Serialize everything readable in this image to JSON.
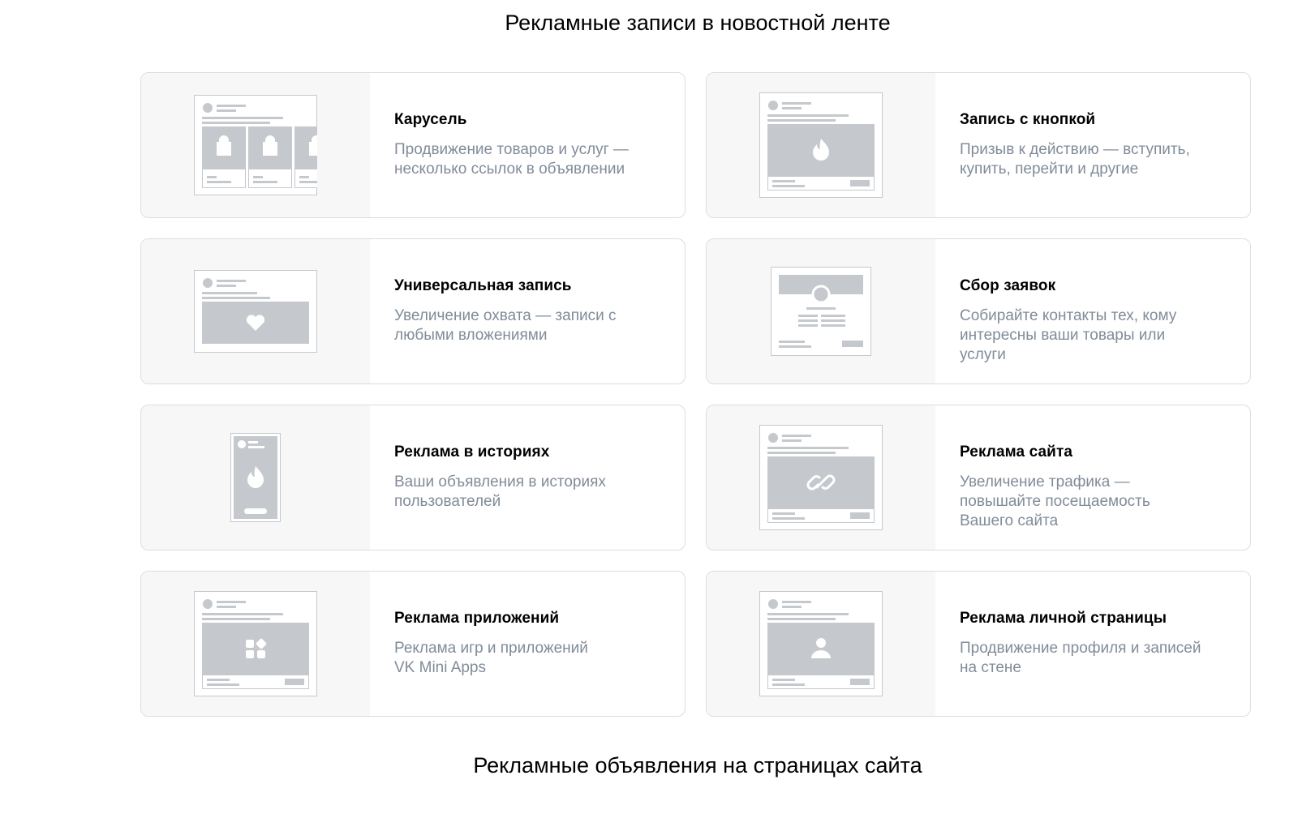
{
  "section_top": {
    "title": "Рекламные записи в новостной ленте"
  },
  "section_bottom": {
    "title": "Рекламные объявления на страницах сайта"
  },
  "cards": [
    {
      "title": "Карусель",
      "desc": "Продвижение товаров и услуг —\nнесколько ссылок в объявлении",
      "icon": "carousel-preview"
    },
    {
      "title": "Запись с кнопкой",
      "desc": "Призыв к действию — вступить,\nкупить, перейти и другие",
      "icon": "button-post-preview"
    },
    {
      "title": "Универсальная запись",
      "desc": "Увеличение охвата — записи с\nлюбыми вложениями",
      "icon": "universal-post-preview"
    },
    {
      "title": "Сбор заявок",
      "desc": "Собирайте контакты тех, кому\nинтересны ваши товары или\nуслуги",
      "icon": "lead-form-preview"
    },
    {
      "title": "Реклама в историях",
      "desc": "Ваши объявления в историях\nпользователей",
      "icon": "stories-preview"
    },
    {
      "title": "Реклама сайта",
      "desc": "Увеличение трафика —\nповышайте посещаемость\nВашего сайта",
      "icon": "site-ad-preview"
    },
    {
      "title": "Реклама приложений",
      "desc": "Реклама игр и приложений\nVK Mini Apps",
      "icon": "app-ad-preview"
    },
    {
      "title": "Реклама личной страницы",
      "desc": "Продвижение профиля и записей\nна стене",
      "icon": "profile-ad-preview"
    }
  ],
  "colors": {
    "card_border": "#dcdde0",
    "preview_bg": "#f7f7f8",
    "placeholder_gray": "#c5c8cc",
    "desc_text": "#818c99"
  }
}
